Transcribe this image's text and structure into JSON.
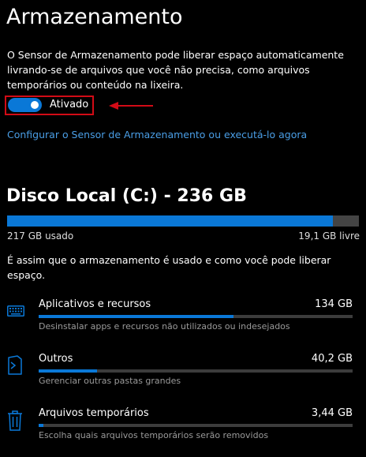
{
  "page": {
    "title": "Armazenamento"
  },
  "sensor": {
    "description": "O Sensor de Armazenamento pode liberar espaço automaticamente livrando-se de arquivos que você não precisa, como arquivos temporários ou conteúdo na lixeira.",
    "toggle_state": true,
    "toggle_label": "Ativado",
    "config_link": "Configurar o Sensor de Armazenamento ou executá-lo agora"
  },
  "drive": {
    "title": "Disco Local (C:) - 236 GB",
    "used_fraction": 0.925,
    "used_label": "217 GB usado",
    "free_label": "19,1 GB livre",
    "usage_text": "É assim que o armazenamento é usado e como você pode liberar espaço."
  },
  "categories": [
    {
      "icon": "keyboard-icon",
      "name": "Aplicativos e recursos",
      "size": "134 GB",
      "fraction": 0.62,
      "description": "Desinstalar apps e recursos não utilizados ou indesejados"
    },
    {
      "icon": "folder-document-icon",
      "name": "Outros",
      "size": "40,2 GB",
      "fraction": 0.185,
      "description": "Gerenciar outras pastas grandes"
    },
    {
      "icon": "trash-icon",
      "name": "Arquivos temporários",
      "size": "3,44 GB",
      "fraction": 0.016,
      "description": "Escolha quais arquivos temporários serão removidos"
    }
  ],
  "colors": {
    "accent": "#0a78d7",
    "annotation": "#d20b16",
    "link": "#4a9ee6",
    "background": "#000000"
  }
}
